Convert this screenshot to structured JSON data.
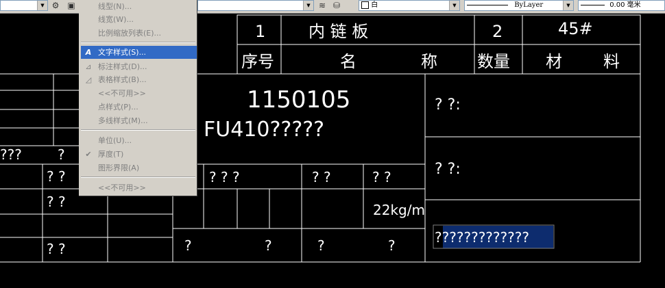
{
  "toolbar": {
    "color_value": "白",
    "linetype_value": "ByLayer",
    "lineweight_value": "0.00 毫米"
  },
  "menu": {
    "items": [
      {
        "label": "线型(N)..."
      },
      {
        "label": "线宽(W)..."
      },
      {
        "label": "比例缩放列表(E)..."
      },
      {
        "label": "文字样式(S)..."
      },
      {
        "label": "标注样式(D)..."
      },
      {
        "label": "表格样式(B)..."
      },
      {
        "label": "<<不可用>>"
      },
      {
        "label": "点样式(P)..."
      },
      {
        "label": "多线样式(M)..."
      },
      {
        "label": "单位(U)..."
      },
      {
        "label": "厚度(T)"
      },
      {
        "label": "图形界限(A)"
      },
      {
        "label": "<<不可用>>"
      }
    ],
    "check_mark": "✔"
  },
  "drawing": {
    "seq_value": "1",
    "part_name": "内 链 板",
    "quantity": "2",
    "material": "45#",
    "col_seq": "序号",
    "col_name_1": "名",
    "col_name_2": "称",
    "col_qty": "数量",
    "col_mat_1": "材",
    "col_mat_2": "料",
    "drawing_number": "1150105",
    "drawing_code": "FU410?????",
    "weight": "22kg/m",
    "q1": "? ?:",
    "q2": "? ?:",
    "selected_text": "?????????????",
    "q_mark": "?",
    "q_pair": "? ?",
    "q_triple": "? ? ?",
    "q_left": "???"
  }
}
